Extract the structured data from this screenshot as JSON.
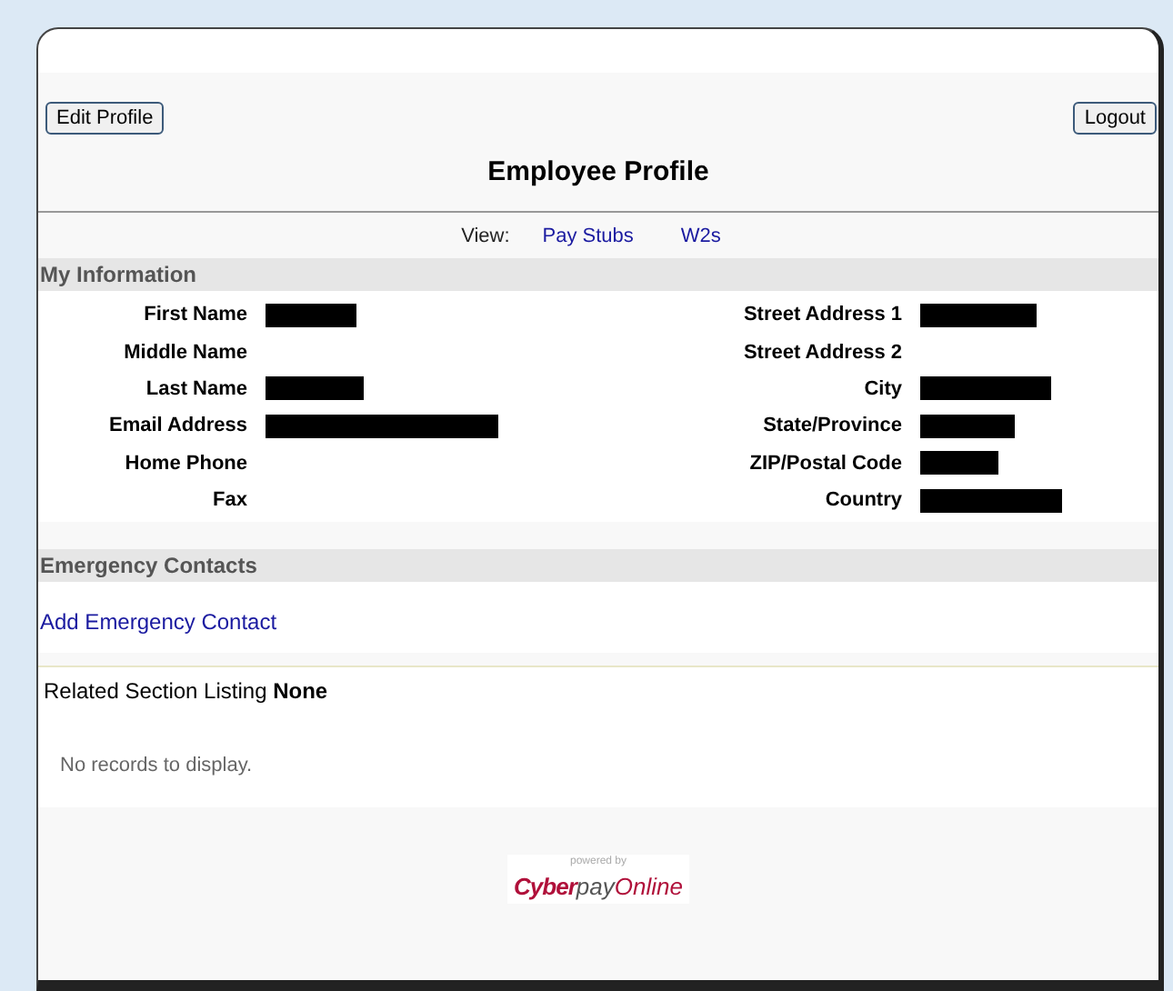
{
  "toolbar": {
    "left_button": "Edit Profile",
    "right_button": "Logout"
  },
  "title": "Employee Profile",
  "view": {
    "label": "View:",
    "links": [
      "Pay Stubs",
      "W2s"
    ]
  },
  "my_information": {
    "heading": "My Information",
    "left_fields": [
      {
        "label": "First Name",
        "redacted": true
      },
      {
        "label": "Middle Name",
        "redacted": false
      },
      {
        "label": "Last Name",
        "redacted": true
      },
      {
        "label": "Email Address",
        "redacted": true
      },
      {
        "label": "Home Phone",
        "redacted": false
      },
      {
        "label": "Fax",
        "redacted": false
      }
    ],
    "right_fields": [
      {
        "label": "Street Address 1",
        "redacted": true
      },
      {
        "label": "Street Address 2",
        "redacted": false
      },
      {
        "label": "City",
        "redacted": true
      },
      {
        "label": "State/Province",
        "redacted": true
      },
      {
        "label": "ZIP/Postal Code",
        "redacted": true
      },
      {
        "label": "Country",
        "redacted": true
      }
    ]
  },
  "emergency_contacts": {
    "heading": "Emergency Contacts",
    "link": "Add Emergency Contact"
  },
  "related": {
    "text": "Related Section Listing **None**",
    "empty_message": "No records to display."
  },
  "footer": {
    "powered_by": "powered by",
    "brand_bold": "Cyber",
    "brand_light": "pay",
    "brand_tail": "Online"
  }
}
